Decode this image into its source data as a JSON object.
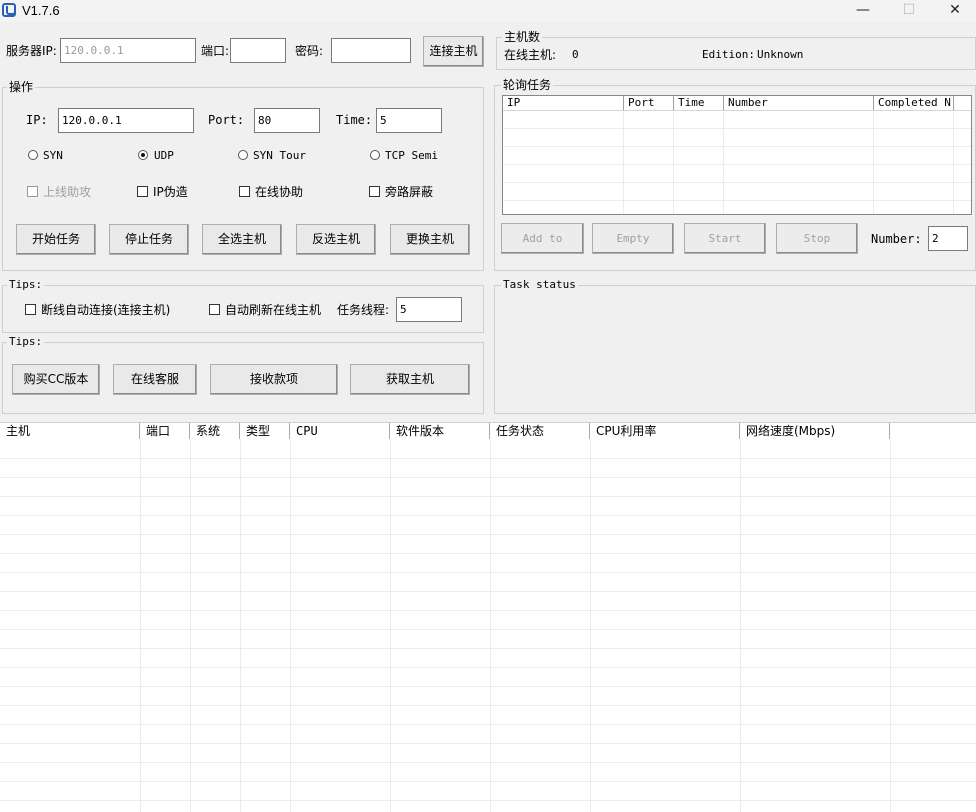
{
  "window": {
    "title": "V1.7.6",
    "minimize": "—",
    "maximize": "☐",
    "close": "✕"
  },
  "connection": {
    "server_ip_label": "服务器IP:",
    "server_ip_value": "120.0.0.1",
    "port_label": "端口:",
    "port_value": "",
    "password_label": "密码:",
    "password_value": "",
    "connect_button": "连接主机"
  },
  "host_count": {
    "title": "主机数",
    "online_label": "在线主机:",
    "online_value": "0",
    "edition_label": "Edition:",
    "edition_value": "Unknown"
  },
  "operation": {
    "title": "操作",
    "ip_label": "IP:",
    "ip_value": "120.0.0.1",
    "port_label": "Port:",
    "port_value": "80",
    "time_label": "Time:",
    "time_value": "5",
    "radios": [
      {
        "label": "SYN",
        "checked": false
      },
      {
        "label": "UDP",
        "checked": true
      },
      {
        "label": "SYN Tour",
        "checked": false
      },
      {
        "label": "TCP Semi",
        "checked": false
      }
    ],
    "checks": [
      {
        "label": "上线助攻",
        "disabled": true
      },
      {
        "label": "IP伪造",
        "disabled": false
      },
      {
        "label": "在线协助",
        "disabled": false
      },
      {
        "label": "旁路屏蔽",
        "disabled": false
      }
    ],
    "buttons": [
      "开始任务",
      "停止任务",
      "全选主机",
      "反选主机",
      "更换主机"
    ]
  },
  "poll_task": {
    "title": "轮询任务",
    "columns": [
      "IP",
      "Port",
      "Time",
      "Number",
      "Completed N"
    ],
    "buttons": [
      "Add to",
      "Empty",
      "Start",
      "Stop"
    ],
    "number_label": "Number:",
    "number_value": "2"
  },
  "tips1": {
    "title": "Tips:",
    "auto_reconnect": "断线自动连接(连接主机)",
    "auto_refresh": "自动刷新在线主机",
    "threads_label": "任务线程:",
    "threads_value": "5"
  },
  "tips2": {
    "title": "Tips:",
    "buttons": [
      "购买CC版本",
      "在线客服",
      "接收款项",
      "获取主机"
    ]
  },
  "task_status": {
    "title": "Task status"
  },
  "host_list": {
    "columns": [
      "主机",
      "端口",
      "系统",
      "类型",
      "CPU",
      "软件版本",
      "任务状态",
      "CPU利用率",
      "网络速度(Mbps)"
    ]
  },
  "colors": {
    "window_bg": "#f0f0f0",
    "icon_blue": "#2b5fb5",
    "disabled_text": "#a0a0a0"
  }
}
